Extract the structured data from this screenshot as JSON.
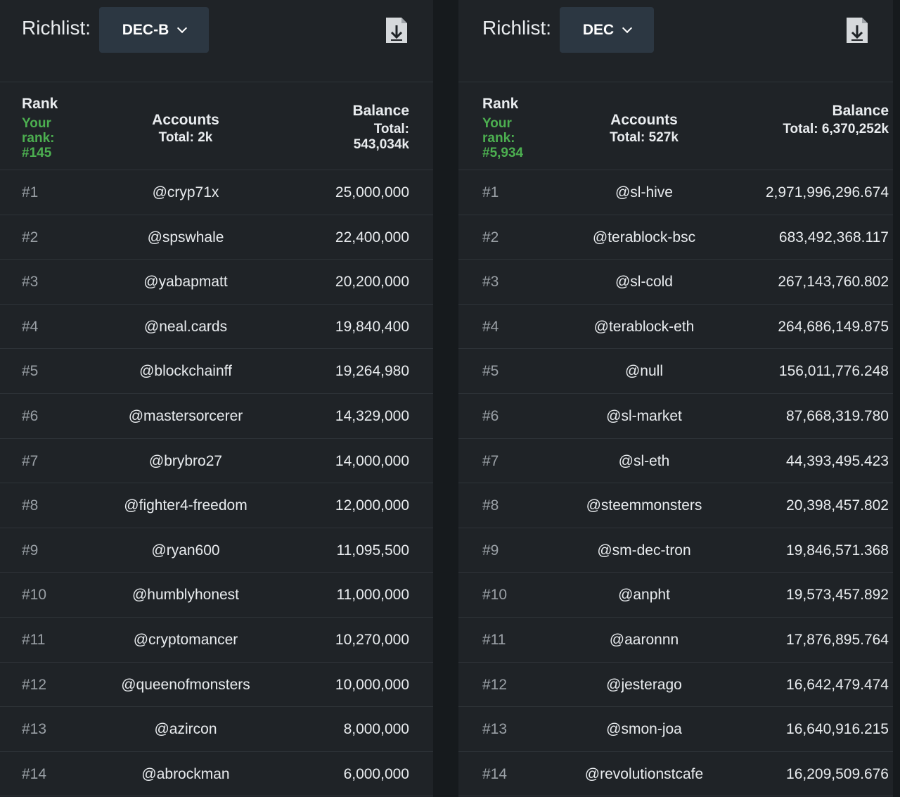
{
  "colors": {
    "page_background": "#161a1d",
    "panel_background": "#1f2327",
    "select_background": "#2c3742",
    "your_rank_green": "#4caf50",
    "rank_text": "#9aa0a6"
  },
  "left": {
    "richlist_label": "Richlist:",
    "token_selected": "DEC-B",
    "download_icon": "download-file-icon",
    "header": {
      "rank": "Rank",
      "your_rank": "Your rank: #145",
      "accounts": "Accounts",
      "accounts_total": "Total: 2k",
      "balance": "Balance",
      "balance_total": "Total: 543,034k"
    },
    "rows": [
      {
        "rank": "#1",
        "account": "@cryp71x",
        "balance": "25,000,000"
      },
      {
        "rank": "#2",
        "account": "@spswhale",
        "balance": "22,400,000"
      },
      {
        "rank": "#3",
        "account": "@yabapmatt",
        "balance": "20,200,000"
      },
      {
        "rank": "#4",
        "account": "@neal.cards",
        "balance": "19,840,400"
      },
      {
        "rank": "#5",
        "account": "@blockchainff",
        "balance": "19,264,980"
      },
      {
        "rank": "#6",
        "account": "@mastersorcerer",
        "balance": "14,329,000"
      },
      {
        "rank": "#7",
        "account": "@brybro27",
        "balance": "14,000,000"
      },
      {
        "rank": "#8",
        "account": "@fighter4-freedom",
        "balance": "12,000,000"
      },
      {
        "rank": "#9",
        "account": "@ryan600",
        "balance": "11,095,500"
      },
      {
        "rank": "#10",
        "account": "@humblyhonest",
        "balance": "11,000,000"
      },
      {
        "rank": "#11",
        "account": "@cryptomancer",
        "balance": "10,270,000"
      },
      {
        "rank": "#12",
        "account": "@queenofmonsters",
        "balance": "10,000,000"
      },
      {
        "rank": "#13",
        "account": "@azircon",
        "balance": "8,000,000"
      },
      {
        "rank": "#14",
        "account": "@abrockman",
        "balance": "6,000,000"
      }
    ]
  },
  "right": {
    "richlist_label": "Richlist:",
    "token_selected": "DEC",
    "download_icon": "download-file-icon",
    "header": {
      "rank": "Rank",
      "your_rank": "Your rank: #5,934",
      "accounts": "Accounts",
      "accounts_total": "Total: 527k",
      "balance": "Balance",
      "balance_total": "Total: 6,370,252k"
    },
    "rows": [
      {
        "rank": "#1",
        "account": "@sl-hive",
        "balance": "2,971,996,296.674"
      },
      {
        "rank": "#2",
        "account": "@terablock-bsc",
        "balance": "683,492,368.117"
      },
      {
        "rank": "#3",
        "account": "@sl-cold",
        "balance": "267,143,760.802"
      },
      {
        "rank": "#4",
        "account": "@terablock-eth",
        "balance": "264,686,149.875"
      },
      {
        "rank": "#5",
        "account": "@null",
        "balance": "156,011,776.248"
      },
      {
        "rank": "#6",
        "account": "@sl-market",
        "balance": "87,668,319.780"
      },
      {
        "rank": "#7",
        "account": "@sl-eth",
        "balance": "44,393,495.423"
      },
      {
        "rank": "#8",
        "account": "@steemmonsters",
        "balance": "20,398,457.802"
      },
      {
        "rank": "#9",
        "account": "@sm-dec-tron",
        "balance": "19,846,571.368"
      },
      {
        "rank": "#10",
        "account": "@anpht",
        "balance": "19,573,457.892"
      },
      {
        "rank": "#11",
        "account": "@aaronnn",
        "balance": "17,876,895.764"
      },
      {
        "rank": "#12",
        "account": "@jesterago",
        "balance": "16,642,479.474"
      },
      {
        "rank": "#13",
        "account": "@smon-joa",
        "balance": "16,640,916.215"
      },
      {
        "rank": "#14",
        "account": "@revolutionstcafe",
        "balance": "16,209,509.676"
      }
    ]
  }
}
